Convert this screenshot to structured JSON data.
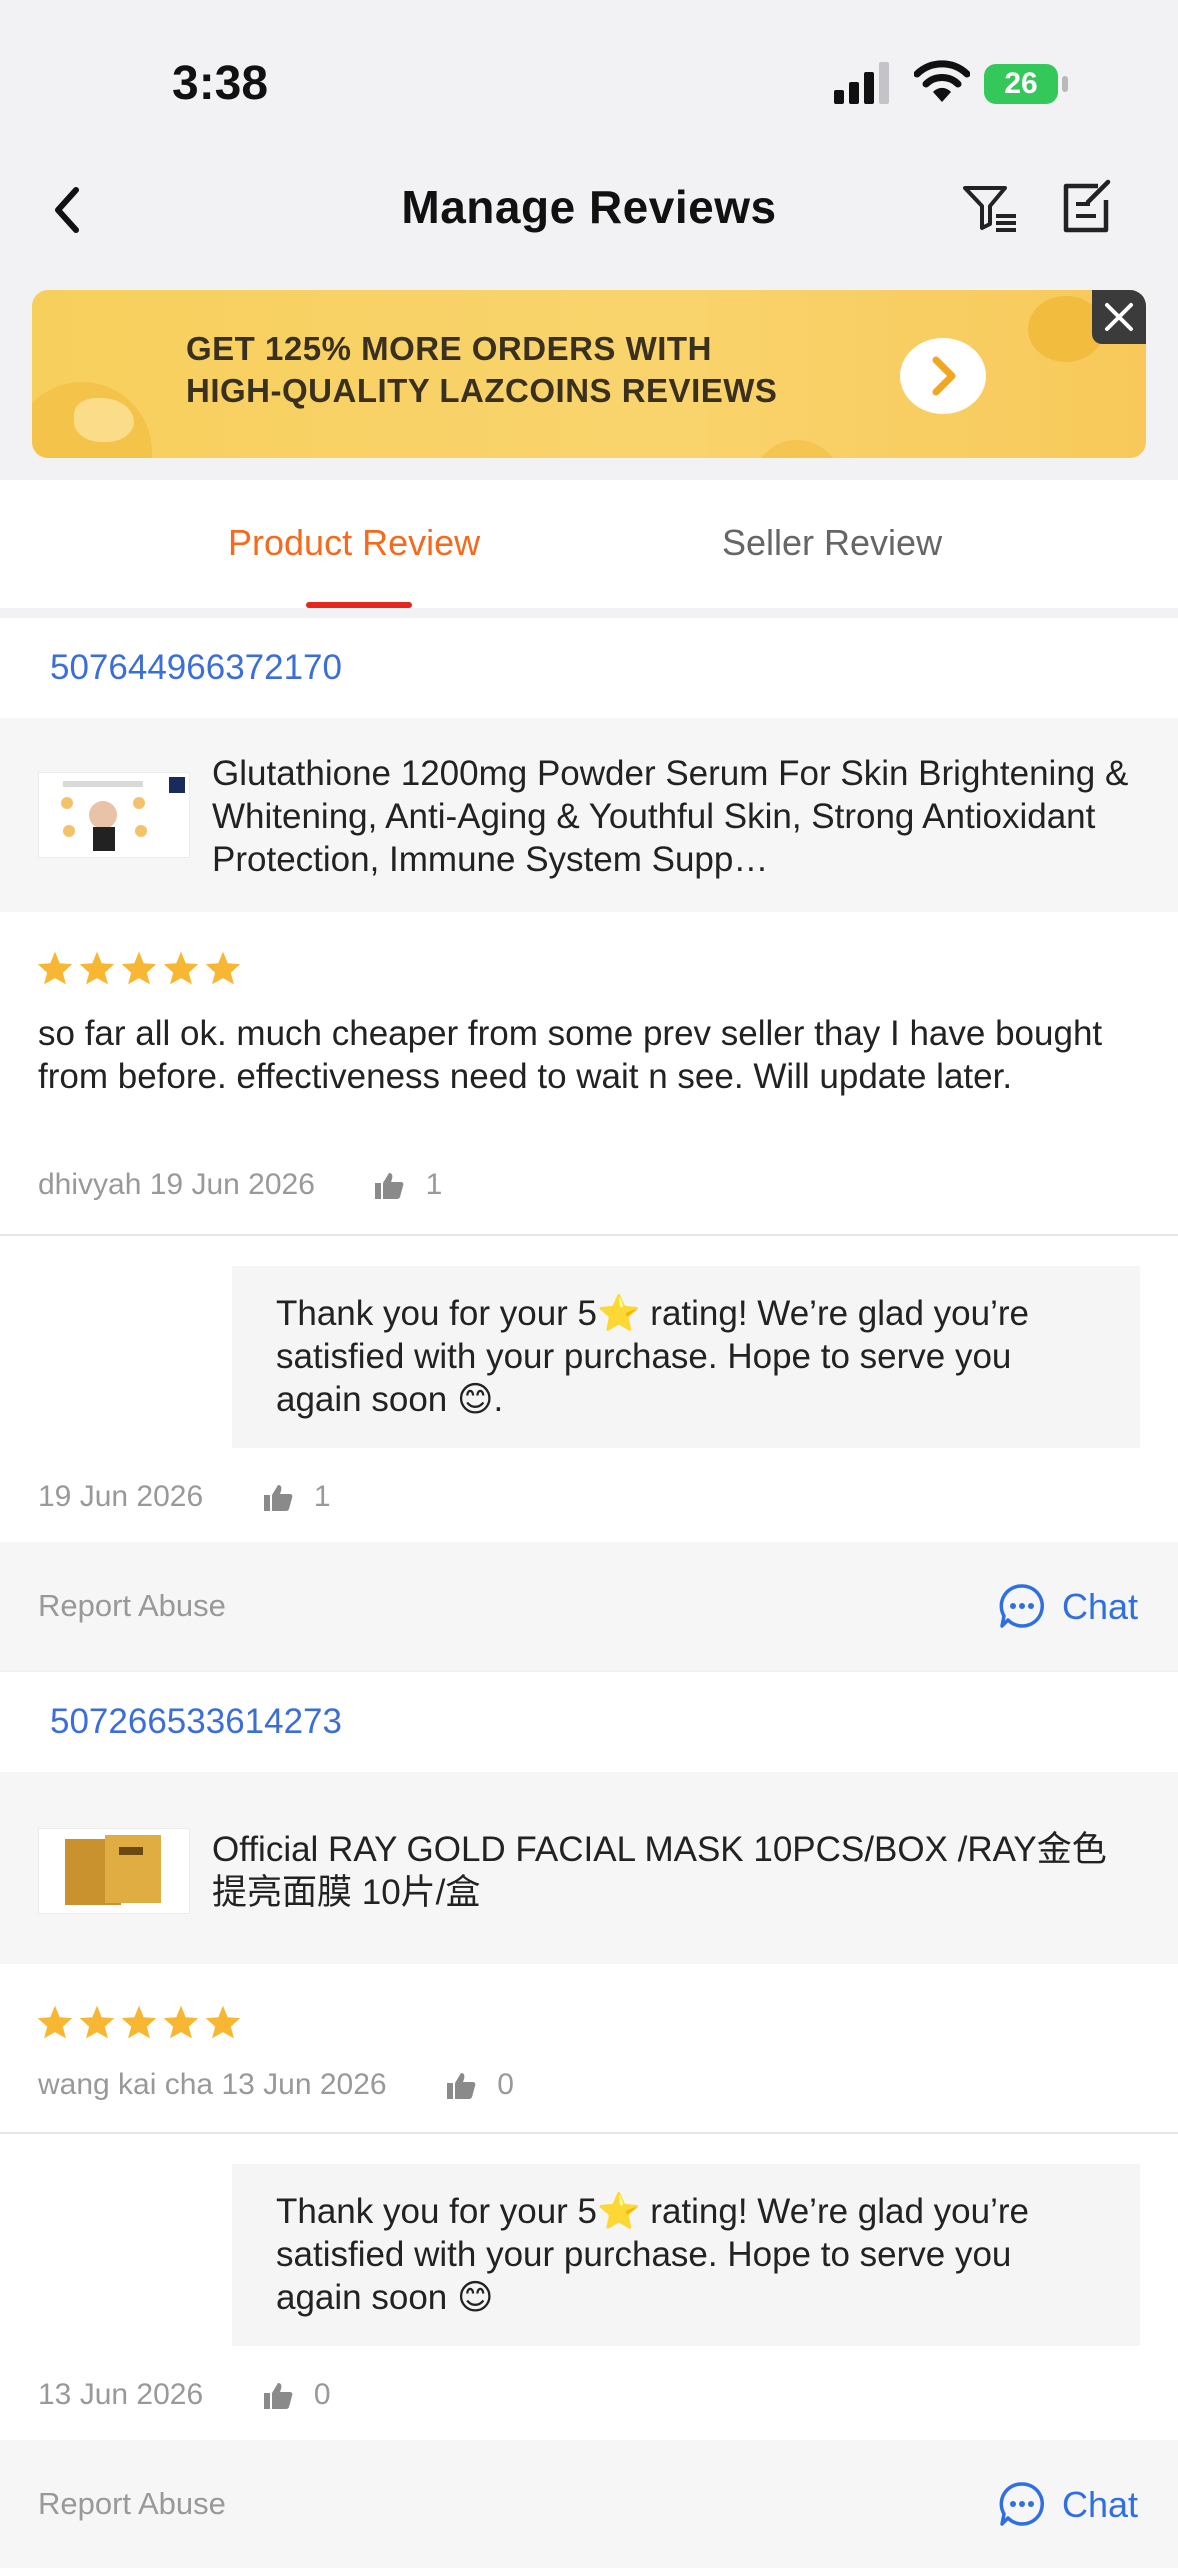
{
  "status_bar": {
    "time": "3:38",
    "battery": "26"
  },
  "header": {
    "title": "Manage Reviews"
  },
  "banner": {
    "line1": "GET 125% MORE ORDERS WITH",
    "line2": "HIGH-QUALITY LAZCOINS REVIEWS"
  },
  "tabs": {
    "product": "Product Review",
    "seller": "Seller Review",
    "active": "product"
  },
  "colors": {
    "accent": "#f56a1c",
    "link": "#3b6ed6",
    "star": "#f7b733",
    "active_underline": "#e5271e"
  },
  "reviews": [
    {
      "order_id": "507644966372170",
      "product_name": "Glutathione 1200mg Powder Serum For Skin Brightening & Whitening, Anti-Aging & Youthful Skin, Strong Antioxidant Protection, Immune System Supp…",
      "rating": 5,
      "text": "so far all ok. much cheaper from some prev seller thay I have bought from before. effectiveness need to wait n see. Will update later.",
      "author_date": "dhivyah 19 Jun 2026",
      "likes": "1",
      "reply_text": "Thank you for your 5⭐ rating! We’re glad you’re satisfied with your purchase. Hope to serve you again soon 😊.",
      "reply_date": "19 Jun 2026",
      "reply_likes": "1",
      "report_label": "Report Abuse",
      "chat_label": "Chat"
    },
    {
      "order_id": "507266533614273",
      "product_name": "Official RAY GOLD FACIAL MASK 10PCS/BOX /RAY金色提亮面膜 10片/盒",
      "rating": 5,
      "text": "",
      "author_date": "wang kai cha 13 Jun 2026",
      "likes": "0",
      "reply_text": "Thank you for your 5⭐ rating! We’re glad you’re satisfied with your purchase. Hope to serve you again soon 😊",
      "reply_date": "13 Jun 2026",
      "reply_likes": "0",
      "report_label": "Report Abuse",
      "chat_label": "Chat"
    }
  ]
}
